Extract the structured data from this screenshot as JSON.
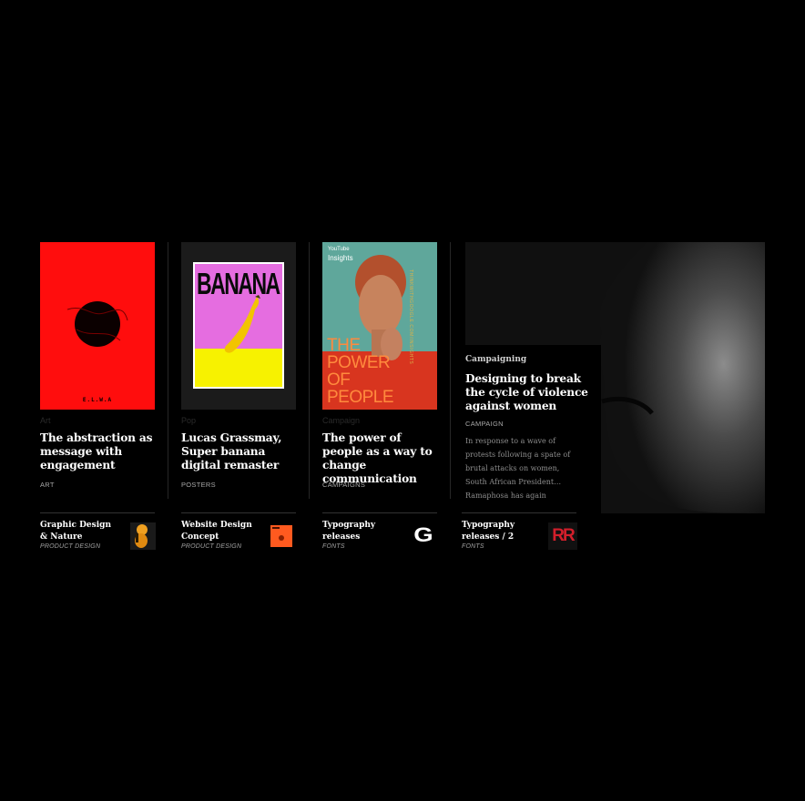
{
  "cards": [
    {
      "category": "Art",
      "title": "The abstraction as message with engagement",
      "tag": "ART",
      "poster_text": "E.L.W.A"
    },
    {
      "category": "Pop",
      "title": "Lucas Grassmay, Super banana digital remaster",
      "tag": "POSTERS",
      "poster_text": "BANANA"
    },
    {
      "category": "Campaign",
      "title": "The power of people as a way to change communication",
      "tag": "CAMPAIGNS",
      "poster_brand": "YouTube",
      "poster_brand2": "Insights",
      "poster_headline": "THE POWER OF PEOPLE",
      "poster_side": "THINKWITHGOOGLE.COM/INSIGHTS"
    }
  ],
  "feature": {
    "category": "Campaigning",
    "title": "Designing to break the cycle of violence against women",
    "tag": "CAMPAIGN",
    "excerpt": "In response to a wave of protests following a spate of brutal attacks on women, South African President… Ramaphosa has again"
  },
  "footer_items": [
    {
      "title": "Graphic Design & Nature",
      "tag": "PRODUCT DESIGN",
      "thumb": "figure-thumbnail"
    },
    {
      "title": "Website Design Concept",
      "tag": "PRODUCT DESIGN",
      "thumb": "orange-poster-thumbnail"
    },
    {
      "title": "Typography releases",
      "tag": "FONTS",
      "thumb": "letter-g-glyph",
      "glyph": "G"
    },
    {
      "title": "Typography releases / 2",
      "tag": "FONTS",
      "thumb": "red-letters-thumbnail",
      "glyph": "RR"
    }
  ],
  "colors": {
    "background": "#000000",
    "red_poster": "#ff0d0d",
    "pink": "#e56de0",
    "yellow": "#f7f200",
    "teal": "#5fa79b",
    "orange": "#ff5a1f"
  }
}
